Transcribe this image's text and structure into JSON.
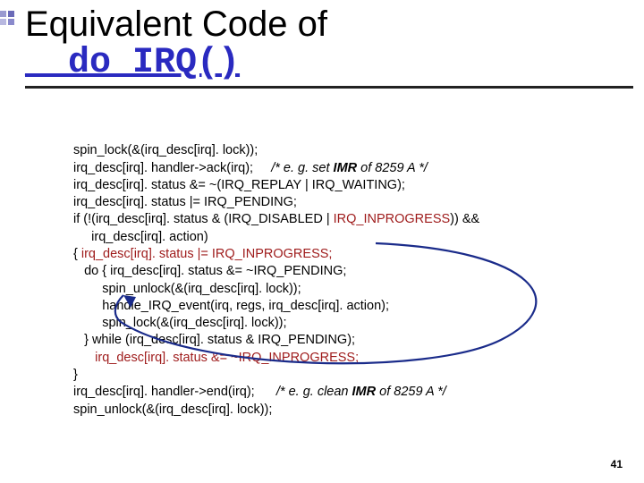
{
  "title": {
    "line1": "Equivalent Code of",
    "fn": "__do_IRQ()"
  },
  "code": {
    "l1": "spin_lock(&(irq_desc[irq]. lock));",
    "l2a": "irq_desc[irq]. handler->ack(irq);     ",
    "l2b": "/* e. g. set ",
    "l2c": "IMR",
    "l2d": " of 8259 A */",
    "l3": "irq_desc[irq]. status &= ~(IRQ_REPLAY | IRQ_WAITING);",
    "l4": "irq_desc[irq]. status |= IRQ_PENDING;",
    "l5a": "if (!(irq_desc[irq]. status & (IRQ_DISABLED | ",
    "l5b": "IRQ_INPROGRESS",
    "l5c": ")) &&",
    "l6": "     irq_desc[irq]. action)",
    "l7a": "{ ",
    "l7b": "irq_desc[irq]. status |= IRQ_INPROGRESS;",
    "l8": "   do { irq_desc[irq]. status &= ~IRQ_PENDING;",
    "l9": "        spin_unlock(&(irq_desc[irq]. lock));",
    "l10": "        handle_IRQ_event(irq, regs, irq_desc[irq]. action);",
    "l11": "        spin_lock(&(irq_desc[irq]. lock));",
    "l12": "   } while (irq_desc[irq]. status & IRQ_PENDING);",
    "l13": "   irq_desc[irq]. status &= ~IRQ_INPROGRESS;",
    "l14": "}",
    "l15a": "irq_desc[irq]. handler->end(irq);      ",
    "l15b": "/* e. g. clean ",
    "l15c": "IMR",
    "l15d": " of 8259 A */",
    "l16": "spin_unlock(&(irq_desc[irq]. lock));"
  },
  "page": "41"
}
